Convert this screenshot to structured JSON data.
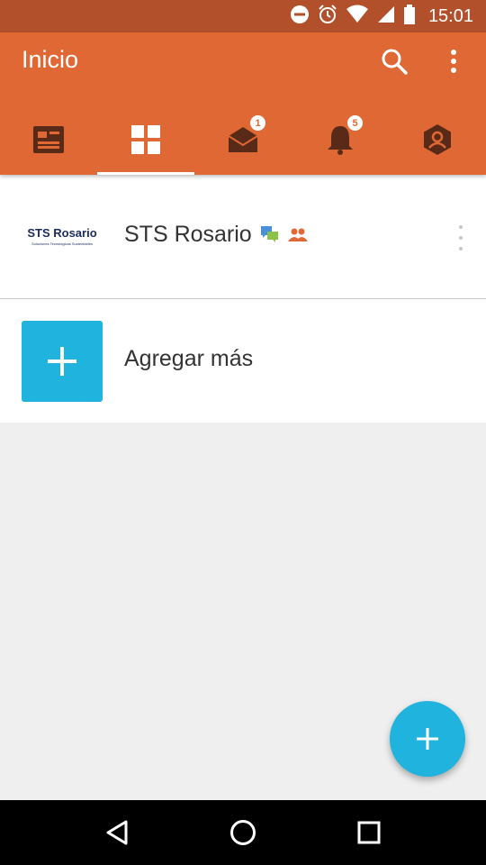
{
  "status_bar": {
    "time": "15:01",
    "icons": [
      "do-not-disturb-icon",
      "alarm-icon",
      "wifi-icon",
      "signal-icon",
      "battery-icon"
    ]
  },
  "app_bar": {
    "title": "Inicio",
    "actions": [
      "search-icon",
      "more-vert-icon"
    ],
    "tabs": [
      {
        "icon": "news-icon",
        "active": false
      },
      {
        "icon": "grid-icon",
        "active": true
      },
      {
        "icon": "mail-icon",
        "active": false,
        "badge": "1"
      },
      {
        "icon": "bell-icon",
        "active": false,
        "badge": "5"
      },
      {
        "icon": "profile-icon",
        "active": false
      }
    ],
    "color": "#e06834",
    "status_color": "#b2502c"
  },
  "list": {
    "items": [
      {
        "title": "STS Rosario",
        "logo_text": "STS Rosario",
        "logo_subtext": "Soluciones Tecnológicas Sustentables",
        "tags": [
          "chat-icon",
          "group-icon"
        ]
      }
    ],
    "add_more_label": "Agregar más"
  },
  "fab": {
    "icon": "plus-icon",
    "color": "#1fb3dd"
  },
  "nav_bar": {
    "buttons": [
      "back-icon",
      "home-icon",
      "recents-icon"
    ]
  }
}
